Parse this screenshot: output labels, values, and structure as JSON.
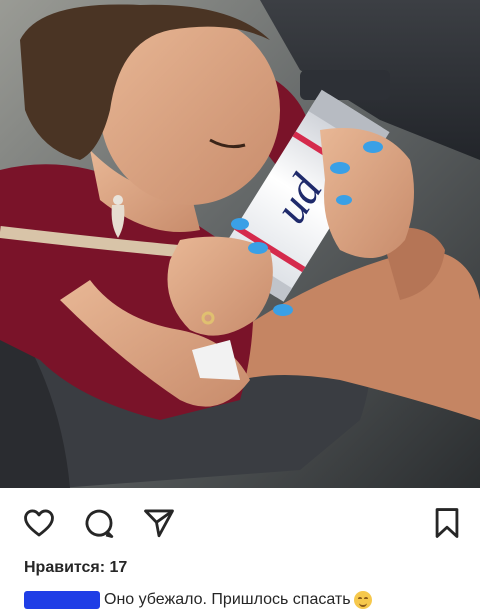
{
  "post": {
    "likes_text": "Нравится: 17",
    "caption_text": "Оно убежало. Пришлось спасать",
    "can_brand": "ud",
    "accent_color": "#1f3ee6"
  },
  "icons": {
    "like": "heart-icon",
    "comment": "comment-bubble-icon",
    "share": "paper-plane-icon",
    "save": "bookmark-icon",
    "emoji": "smiling-face-icon"
  }
}
